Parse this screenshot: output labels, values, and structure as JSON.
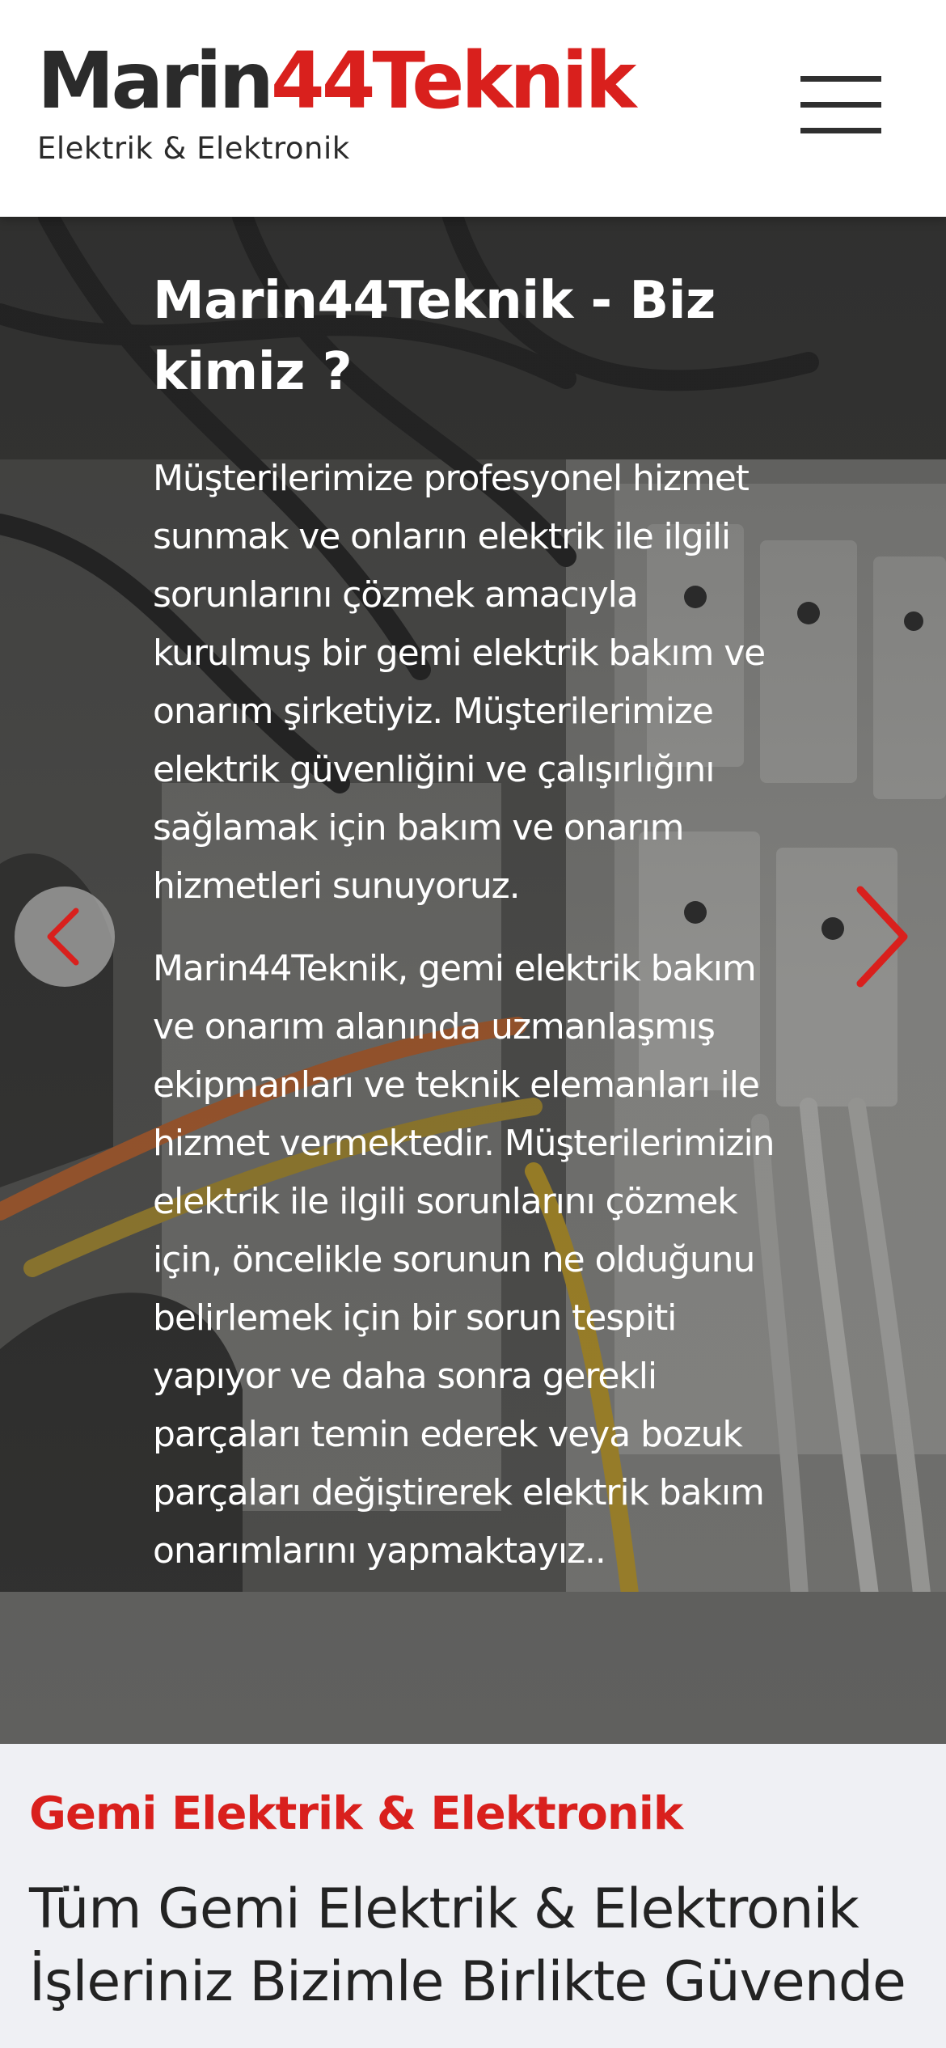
{
  "header": {
    "logo_part1": "Marin",
    "logo_part2": "44Teknik",
    "logo_tagline": "Elektrik & Elektronik",
    "menu_icon": "hamburger-menu-icon"
  },
  "hero": {
    "title": "Marin44Teknik - Biz kimiz ?",
    "paragraph1": "Müşterilerimize profesyonel hizmet sunmak ve onların elektrik ile ilgili sorunlarını çözmek amacıyla kurulmuş bir gemi elektrik bakım ve onarım şirketiyiz. Müşterilerimize elektrik güvenliğini ve çalışırlığını sağlamak için bakım ve onarım hizmetleri sunuyoruz.",
    "paragraph2": "Marin44Teknik, gemi elektrik bakım ve onarım alanında uzmanlaşmış ekipmanları ve teknik elemanları ile hizmet vermektedir. Müşterilerimizin elektrik ile ilgili sorunlarını çözmek için, öncelikle sorunun ne olduğunu belirlemek için bir sorun tespiti yapıyor ve daha sonra gerekli parçaları temin ederek veya bozuk parçaları değiştirerek elektrik bakım onarımlarını yapmaktayız..",
    "prev_icon": "chevron-left-icon",
    "next_icon": "chevron-right-icon"
  },
  "section": {
    "eyebrow": "Gemi Elektrik & Elektronik",
    "heading": "Tüm Gemi Elektrik & Elektronik İşleriniz Bizimle Birlikte Güvende"
  },
  "colors": {
    "brand_red": "#d9201d",
    "dark_text": "#2b2b2b",
    "section_bg": "#eff0f4"
  }
}
